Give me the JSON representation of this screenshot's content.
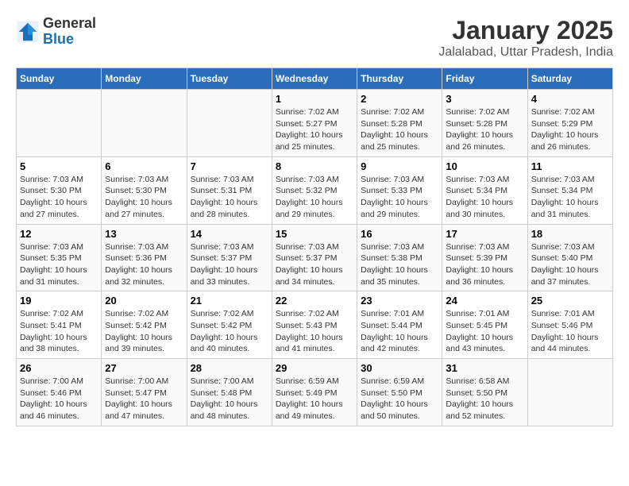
{
  "header": {
    "logo_general": "General",
    "logo_blue": "Blue",
    "title": "January 2025",
    "subtitle": "Jalalabad, Uttar Pradesh, India"
  },
  "columns": [
    "Sunday",
    "Monday",
    "Tuesday",
    "Wednesday",
    "Thursday",
    "Friday",
    "Saturday"
  ],
  "weeks": [
    [
      {
        "day": "",
        "info": ""
      },
      {
        "day": "",
        "info": ""
      },
      {
        "day": "",
        "info": ""
      },
      {
        "day": "1",
        "info": "Sunrise: 7:02 AM\nSunset: 5:27 PM\nDaylight: 10 hours\nand 25 minutes."
      },
      {
        "day": "2",
        "info": "Sunrise: 7:02 AM\nSunset: 5:28 PM\nDaylight: 10 hours\nand 25 minutes."
      },
      {
        "day": "3",
        "info": "Sunrise: 7:02 AM\nSunset: 5:28 PM\nDaylight: 10 hours\nand 26 minutes."
      },
      {
        "day": "4",
        "info": "Sunrise: 7:02 AM\nSunset: 5:29 PM\nDaylight: 10 hours\nand 26 minutes."
      }
    ],
    [
      {
        "day": "5",
        "info": "Sunrise: 7:03 AM\nSunset: 5:30 PM\nDaylight: 10 hours\nand 27 minutes."
      },
      {
        "day": "6",
        "info": "Sunrise: 7:03 AM\nSunset: 5:30 PM\nDaylight: 10 hours\nand 27 minutes."
      },
      {
        "day": "7",
        "info": "Sunrise: 7:03 AM\nSunset: 5:31 PM\nDaylight: 10 hours\nand 28 minutes."
      },
      {
        "day": "8",
        "info": "Sunrise: 7:03 AM\nSunset: 5:32 PM\nDaylight: 10 hours\nand 29 minutes."
      },
      {
        "day": "9",
        "info": "Sunrise: 7:03 AM\nSunset: 5:33 PM\nDaylight: 10 hours\nand 29 minutes."
      },
      {
        "day": "10",
        "info": "Sunrise: 7:03 AM\nSunset: 5:34 PM\nDaylight: 10 hours\nand 30 minutes."
      },
      {
        "day": "11",
        "info": "Sunrise: 7:03 AM\nSunset: 5:34 PM\nDaylight: 10 hours\nand 31 minutes."
      }
    ],
    [
      {
        "day": "12",
        "info": "Sunrise: 7:03 AM\nSunset: 5:35 PM\nDaylight: 10 hours\nand 31 minutes."
      },
      {
        "day": "13",
        "info": "Sunrise: 7:03 AM\nSunset: 5:36 PM\nDaylight: 10 hours\nand 32 minutes."
      },
      {
        "day": "14",
        "info": "Sunrise: 7:03 AM\nSunset: 5:37 PM\nDaylight: 10 hours\nand 33 minutes."
      },
      {
        "day": "15",
        "info": "Sunrise: 7:03 AM\nSunset: 5:37 PM\nDaylight: 10 hours\nand 34 minutes."
      },
      {
        "day": "16",
        "info": "Sunrise: 7:03 AM\nSunset: 5:38 PM\nDaylight: 10 hours\nand 35 minutes."
      },
      {
        "day": "17",
        "info": "Sunrise: 7:03 AM\nSunset: 5:39 PM\nDaylight: 10 hours\nand 36 minutes."
      },
      {
        "day": "18",
        "info": "Sunrise: 7:03 AM\nSunset: 5:40 PM\nDaylight: 10 hours\nand 37 minutes."
      }
    ],
    [
      {
        "day": "19",
        "info": "Sunrise: 7:02 AM\nSunset: 5:41 PM\nDaylight: 10 hours\nand 38 minutes."
      },
      {
        "day": "20",
        "info": "Sunrise: 7:02 AM\nSunset: 5:42 PM\nDaylight: 10 hours\nand 39 minutes."
      },
      {
        "day": "21",
        "info": "Sunrise: 7:02 AM\nSunset: 5:42 PM\nDaylight: 10 hours\nand 40 minutes."
      },
      {
        "day": "22",
        "info": "Sunrise: 7:02 AM\nSunset: 5:43 PM\nDaylight: 10 hours\nand 41 minutes."
      },
      {
        "day": "23",
        "info": "Sunrise: 7:01 AM\nSunset: 5:44 PM\nDaylight: 10 hours\nand 42 minutes."
      },
      {
        "day": "24",
        "info": "Sunrise: 7:01 AM\nSunset: 5:45 PM\nDaylight: 10 hours\nand 43 minutes."
      },
      {
        "day": "25",
        "info": "Sunrise: 7:01 AM\nSunset: 5:46 PM\nDaylight: 10 hours\nand 44 minutes."
      }
    ],
    [
      {
        "day": "26",
        "info": "Sunrise: 7:00 AM\nSunset: 5:46 PM\nDaylight: 10 hours\nand 46 minutes."
      },
      {
        "day": "27",
        "info": "Sunrise: 7:00 AM\nSunset: 5:47 PM\nDaylight: 10 hours\nand 47 minutes."
      },
      {
        "day": "28",
        "info": "Sunrise: 7:00 AM\nSunset: 5:48 PM\nDaylight: 10 hours\nand 48 minutes."
      },
      {
        "day": "29",
        "info": "Sunrise: 6:59 AM\nSunset: 5:49 PM\nDaylight: 10 hours\nand 49 minutes."
      },
      {
        "day": "30",
        "info": "Sunrise: 6:59 AM\nSunset: 5:50 PM\nDaylight: 10 hours\nand 50 minutes."
      },
      {
        "day": "31",
        "info": "Sunrise: 6:58 AM\nSunset: 5:50 PM\nDaylight: 10 hours\nand 52 minutes."
      },
      {
        "day": "",
        "info": ""
      }
    ]
  ]
}
